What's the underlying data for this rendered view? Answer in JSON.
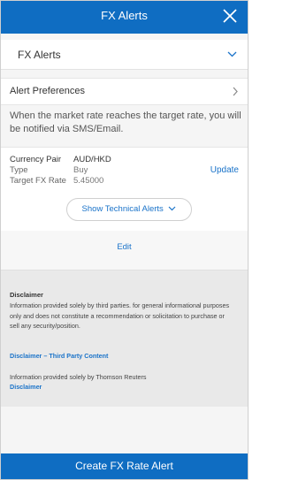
{
  "header": {
    "title": "FX Alerts",
    "close_icon": "close-icon"
  },
  "alert_type_dropdown": {
    "selected": "FX Alerts",
    "icon": "chevron-down-icon"
  },
  "preferences": {
    "label": "Alert Preferences",
    "icon": "chevron-right-icon"
  },
  "info_text": "When the market rate reaches the target rate, you will be notified via SMS/Email.",
  "alert": {
    "currency_pair_label": "Currency Pair",
    "currency_pair_value": "AUD/HKD",
    "type_label": "Type",
    "type_value": "Buy",
    "target_rate_label": "Target FX Rate",
    "target_rate_value": "5.45000",
    "update_label": "Update",
    "technical_alerts_label": "Show Technical Alerts"
  },
  "edit_label": "Edit",
  "disclaimer": {
    "title": "Disclaimer",
    "text": "Information provided solely by third parties. for general informational purposes only and does not constitute a recommendation or solicitation to purchase or sell any security/position.",
    "third_party_link": "Disclaimer – Third Party Content",
    "reuters_text": "Information provided solely by Thomson Reuters",
    "reuters_link": "Disclaimer"
  },
  "cta_label": "Create FX Rate Alert",
  "colors": {
    "brand_blue": "#0f6dc2",
    "link_blue": "#1a73c9",
    "disclaimer_bg": "#e9e9e9"
  }
}
